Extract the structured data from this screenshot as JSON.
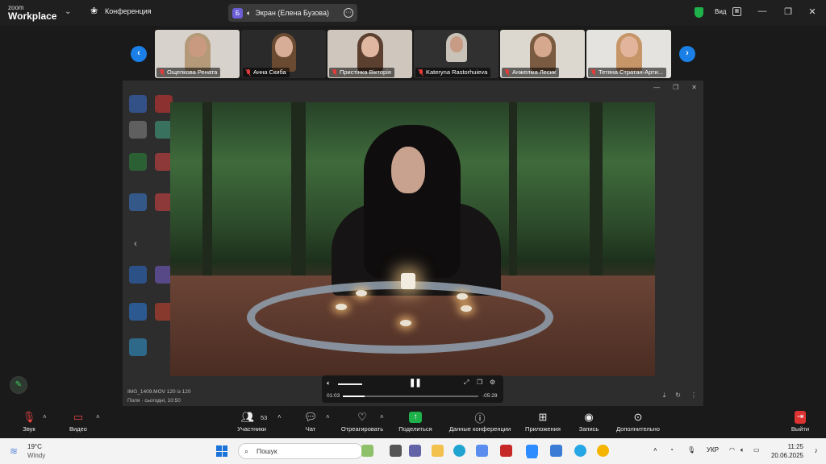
{
  "app": {
    "logo_line1": "zoom",
    "logo_line2": "Workplace",
    "conference_tab": "Конференция",
    "screen_tab_badge": "Б",
    "screen_tab": "Экран (Елена Бузова)",
    "view_label": "Вид"
  },
  "gallery": {
    "participants": [
      {
        "name": "Ощепкова Рената"
      },
      {
        "name": "Анна Скиба"
      },
      {
        "name": "Пристінка Вікторія"
      },
      {
        "name": "Kateryna Rastorhuieva"
      },
      {
        "name": "Анжеліка Лесик"
      },
      {
        "name": "Тетяна Стратан-Арти..."
      }
    ]
  },
  "player": {
    "time_current": "01:03",
    "time_remaining": "-05:29",
    "progress": 0.16,
    "volume": 0.35,
    "file_name": "IMG_1409.MOV 120 із 120",
    "file_meta": "Поля · сьогодні, 10:50"
  },
  "toolbar": {
    "audio_label": "Звук",
    "video_label": "Видео",
    "participants_label": "Участники",
    "participants_count": "53",
    "chat_label": "Чат",
    "react_label": "Отреагировать",
    "share_label": "Поделиться",
    "details_label": "Данные конференции",
    "apps_label": "Приложения",
    "record_label": "Запись",
    "more_label": "Дополнительно",
    "leave_label": "Выйти"
  },
  "taskbar": {
    "temperature": "19°C",
    "weather": "Windy",
    "search_placeholder": "Пошук",
    "language": "УКР",
    "time": "11:25",
    "date": "20.06.2025"
  }
}
